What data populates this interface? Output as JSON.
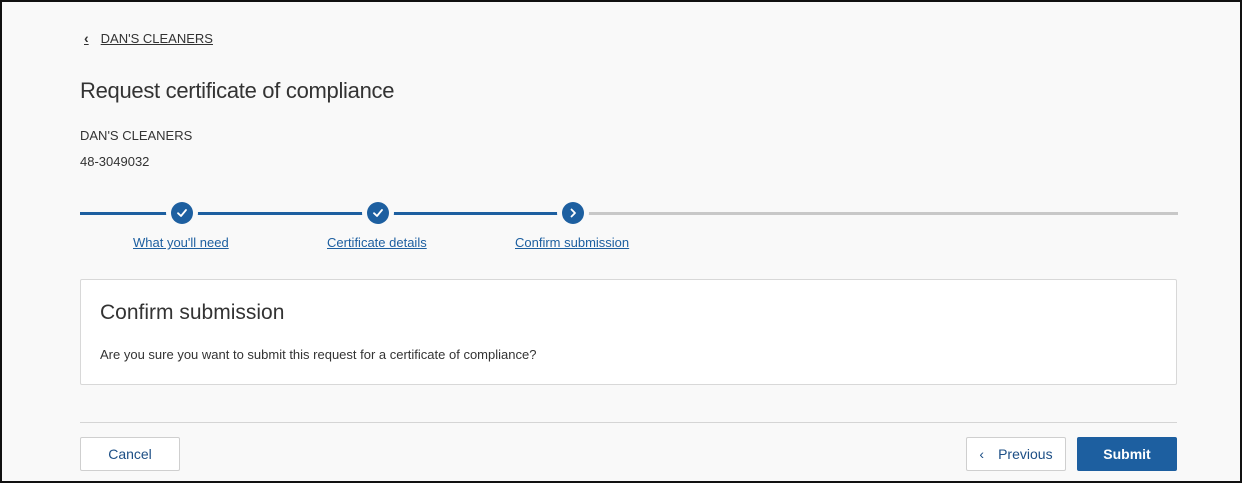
{
  "nav": {
    "back_label": "DAN'S CLEANERS"
  },
  "header": {
    "title": "Request certificate of compliance",
    "business_name": "DAN'S CLEANERS",
    "business_id": "48-3049032"
  },
  "progress": {
    "steps": [
      {
        "label": "What you'll need",
        "status": "complete",
        "icon": "check-icon"
      },
      {
        "label": "Certificate details",
        "status": "complete",
        "icon": "check-icon"
      },
      {
        "label": "Confirm submission",
        "status": "current",
        "icon": "chevron-right-icon"
      }
    ],
    "colors": {
      "done": "#1d5fa0",
      "todo": "#c8c8c8"
    }
  },
  "card": {
    "heading": "Confirm submission",
    "body": "Are you sure you want to submit this request for a certificate of compliance?"
  },
  "actions": {
    "cancel_label": "Cancel",
    "previous_label": "Previous",
    "submit_label": "Submit"
  },
  "colors": {
    "accent": "#1d5fa0"
  }
}
